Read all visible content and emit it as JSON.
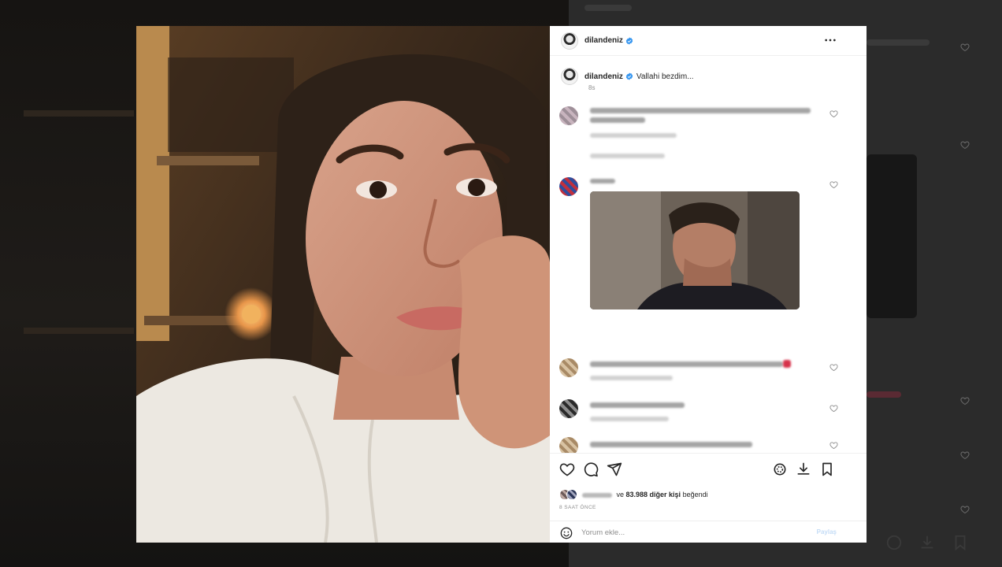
{
  "post": {
    "username": "dilandeniz",
    "caption_username": "dilandeniz",
    "caption": "Vallahi bezdim...",
    "time": "8s",
    "likes_middle": " ve ",
    "likes_count": "83.988 diğer kişi",
    "likes_suffix": " beğendi",
    "date": "8 SAAT ÖNCE"
  },
  "comment_box": {
    "placeholder": "Yorum ekle...",
    "submit_label": "Paylaş"
  },
  "icons": {
    "verified": "verified-badge-icon",
    "more": "more-options-icon",
    "like": "heart-icon",
    "comment": "comment-bubble-icon",
    "share": "paper-plane-icon",
    "audio": "audio-icon",
    "download": "download-icon",
    "save": "bookmark-icon",
    "emoji": "emoji-smile-icon"
  },
  "colors": {
    "verified": "#3897f0",
    "text": "#262626",
    "muted": "#8e8e8e",
    "accent_red": "#d6314a"
  }
}
